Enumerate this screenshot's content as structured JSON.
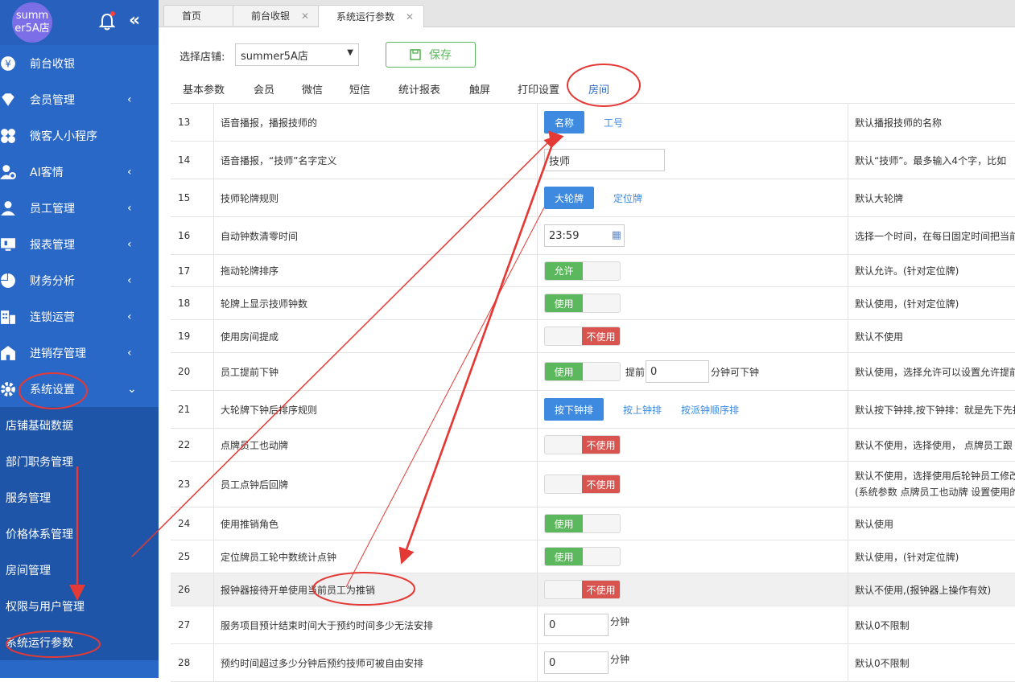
{
  "sidebar": {
    "avatar_text": "summer5A店",
    "menu": [
      {
        "label": "前台收银",
        "has_arrow": false,
        "icon": "yen-icon"
      },
      {
        "label": "会员管理",
        "has_arrow": true,
        "icon": "diamond-icon"
      },
      {
        "label": "微客人小程序",
        "has_arrow": false,
        "icon": "clover-icon"
      },
      {
        "label": "AI客情",
        "has_arrow": true,
        "icon": "user-gear-icon"
      },
      {
        "label": "员工管理",
        "has_arrow": true,
        "icon": "user-icon"
      },
      {
        "label": "报表管理",
        "has_arrow": true,
        "icon": "monitor-icon"
      },
      {
        "label": "财务分析",
        "has_arrow": true,
        "icon": "pie-icon"
      },
      {
        "label": "连锁运营",
        "has_arrow": true,
        "icon": "building-icon"
      },
      {
        "label": "进销存管理",
        "has_arrow": true,
        "icon": "store-icon"
      },
      {
        "label": "系统设置",
        "has_arrow": true,
        "icon": "gear-icon",
        "expanded": true
      }
    ],
    "submenu": [
      "店铺基础数据",
      "部门职务管理",
      "服务管理",
      "价格体系管理",
      "房间管理",
      "权限与用户管理",
      "系统运行参数"
    ]
  },
  "tabs": [
    {
      "label": "首页",
      "closable": false
    },
    {
      "label": "前台收银",
      "closable": true
    },
    {
      "label": "系统运行参数",
      "closable": true,
      "active": true
    }
  ],
  "toolbar": {
    "store_label": "选择店铺:",
    "store_value": "summer5A店",
    "save_label": "保存"
  },
  "subtabs": [
    "基本参数",
    "会员",
    "微信",
    "短信",
    "统计报表",
    "触屏",
    "打印设置",
    "房间"
  ],
  "active_subtab": "房间",
  "rows": [
    {
      "num": "13",
      "name": "语音播报，播报技师的",
      "desc": "默认播报技师的名称",
      "btn": "名称",
      "links": [
        "工号"
      ]
    },
    {
      "num": "14",
      "name": "语音播报，“技师”名字定义",
      "desc": "默认“技师”。最多输入4个字，比如",
      "input": "技师"
    },
    {
      "num": "15",
      "name": "技师轮牌规则",
      "desc": "默认大轮牌",
      "btn": "大轮牌",
      "links": [
        "定位牌"
      ]
    },
    {
      "num": "16",
      "name": "自动钟数清零时间",
      "desc": "选择一个时间，在每日固定时间把当前",
      "input": "23:59"
    },
    {
      "num": "17",
      "name": "拖动轮牌排序",
      "desc": "默认允许。(针对定位牌)",
      "toggle_on": "允许"
    },
    {
      "num": "18",
      "name": "轮牌上显示技师钟数",
      "desc": "默认使用，(针对定位牌)",
      "toggle_on": "使用"
    },
    {
      "num": "19",
      "name": "使用房间提成",
      "desc": "默认不使用",
      "toggle_off": "不使用"
    },
    {
      "num": "20",
      "name": "员工提前下钟",
      "desc": "默认使用，选择允许可以设置允许提前",
      "toggle_on": "使用",
      "pre": "提前",
      "input": "0",
      "post": "分钟可下钟"
    },
    {
      "num": "21",
      "name": "大轮牌下钟后排序规则",
      "desc": "默认按下钟排,按下钟排：就是先下先排",
      "btn": "按下钟排",
      "links": [
        "按上钟排",
        "按派钟顺序排"
      ]
    },
    {
      "num": "22",
      "name": "点牌员工也动牌",
      "desc": "默认不使用，选择使用， 点牌员工跟",
      "toggle_off": "不使用"
    },
    {
      "num": "23",
      "name": "员工点钟后回牌",
      "desc": "默认不使用，选择使用后轮钟员工修改",
      "desc2": "(系统参数 点牌员工也动牌 设置使用的",
      "toggle_off": "不使用"
    },
    {
      "num": "24",
      "name": "使用推销角色",
      "desc": "默认使用",
      "toggle_on": "使用"
    },
    {
      "num": "25",
      "name": "定位牌员工轮中数统计点钟",
      "desc": "默认使用，(针对定位牌)",
      "toggle_on": "使用"
    },
    {
      "num": "26",
      "name": "报钟器接待开单使用当前员工为推销",
      "desc": "默认不使用,(报钟器上操作有效)",
      "toggle_off": "不使用",
      "highlight": true
    },
    {
      "num": "27",
      "name": "服务项目预计结束时间大于预约时间多少无法安排",
      "desc": "默认0不限制",
      "input": "0",
      "post": "分钟"
    },
    {
      "num": "28",
      "name": "预约时间超过多少分钟后预约技师可被自由安排",
      "desc": "默认0不限制",
      "input": "0",
      "post": "分钟"
    }
  ],
  "colors": {
    "sidebar": "#2a68c8",
    "accent": "#3d8ae0",
    "on": "#5cb85c",
    "off": "#d9534f",
    "annotation": "#e53935"
  }
}
